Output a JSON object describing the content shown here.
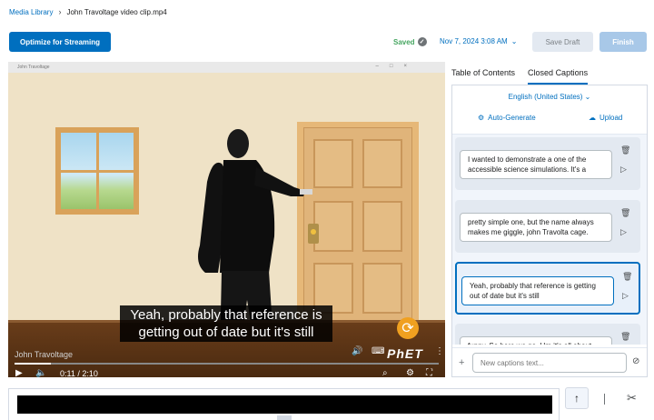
{
  "breadcrumb": {
    "parent": "Media Library",
    "separator": "›",
    "current": "John Travoltage video clip.mp4"
  },
  "toolbar": {
    "optimize_label": "Optimize for Streaming",
    "saved_label": "Saved",
    "date_label": "Nov 7, 2024 3:08 AM",
    "save_draft_label": "Save Draft",
    "finish_label": "Finish"
  },
  "video": {
    "window_title": "John Travoltage",
    "caption_lines": [
      "Yeah, probably that reference is",
      "getting out of date but it's still"
    ],
    "watermark": "John Travoltage",
    "time": "0:11 / 2:10",
    "progress": 0.085,
    "brand": "PhET"
  },
  "tabs": [
    {
      "label": "Table of Contents",
      "active": false
    },
    {
      "label": "Closed Captions",
      "active": true
    }
  ],
  "captions_panel": {
    "language": "English (United States)",
    "auto_generate_label": "Auto-Generate",
    "upload_label": "Upload",
    "items": [
      {
        "text": "I wanted to demonstrate a one of the accessible science simulations. It's a"
      },
      {
        "text": "pretty simple one, but the name always makes me giggle, john Travolta cage."
      },
      {
        "text": "Yeah, probably that reference is getting out of date but it's still"
      },
      {
        "text": "funny. So here we go. Um it's all about"
      }
    ],
    "new_caption_placeholder": "New captions text..."
  },
  "colors": {
    "accent": "#006fbf",
    "saved": "#46a661",
    "selected_border": "#006fbf"
  }
}
